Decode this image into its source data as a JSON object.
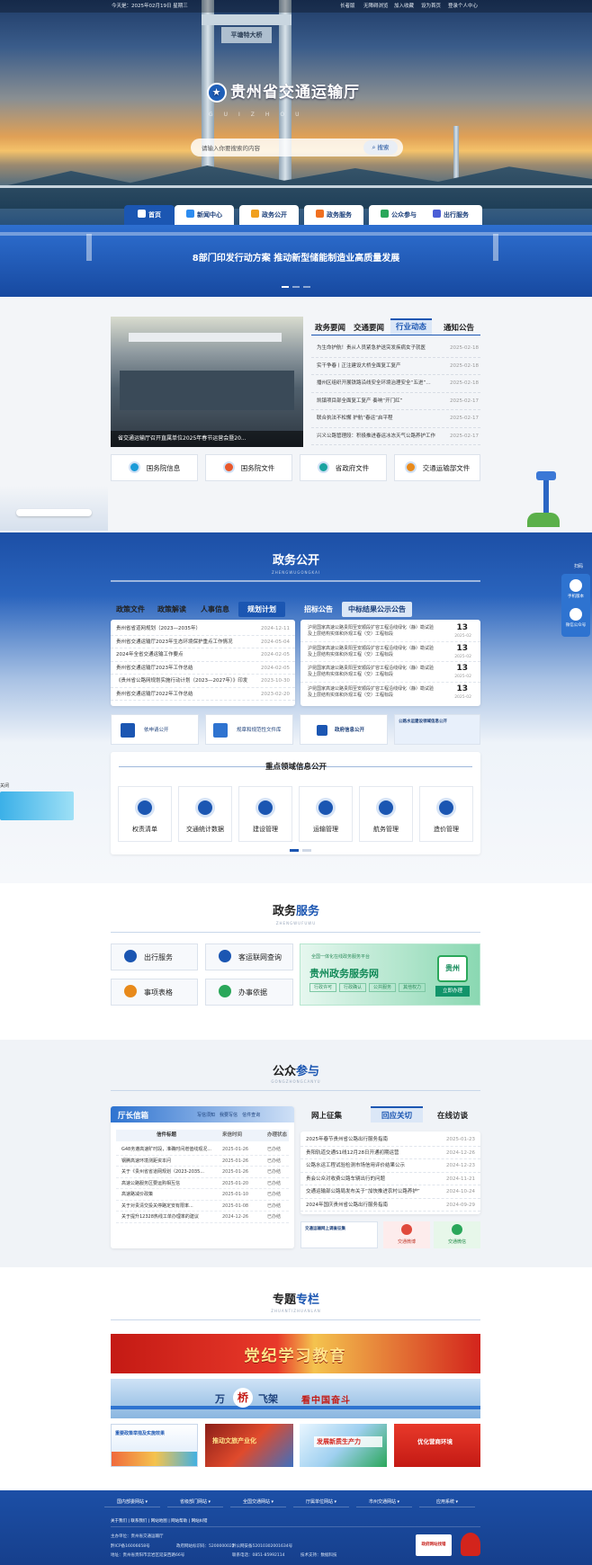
{
  "topbar": {
    "date": "今天是：2025年02月19日 星期三",
    "links": [
      "长者版",
      "无障碍浏览",
      "加入收藏",
      "设为首页",
      "登录个人中心"
    ]
  },
  "site": {
    "name": "贵州省交通运输厅",
    "pinyin": "GUIZHOU",
    "search_placeholder": "请输入你要搜索的内容",
    "search_button": "搜索",
    "bridge_text": "平塘特大桥"
  },
  "nav": {
    "items": [
      "首页",
      "新闻中心",
      "政务公开",
      "政务服务",
      "公众参与",
      "出行服务"
    ]
  },
  "banner": {
    "headline": "8部门印发行动方案 推动新型储能制造业高质量发展"
  },
  "news": {
    "photo_caption": "省交通运输厅召开直属单位2025年春节运营会暨20...",
    "tabs": [
      "政务要闻",
      "交通要闻",
      "行业动态",
      "通知公告"
    ],
    "items": [
      {
        "title": "为生命护航！贵从人员紧急护送突发疾病女子就医",
        "date": "2025-02-18"
      },
      {
        "title": "实干争春丨正注建设大桥全面复工复产",
        "date": "2025-02-18"
      },
      {
        "title": "播州区组织开展铁路沿线安全环境治理安全“五进”宣传",
        "date": "2025-02-18"
      },
      {
        "title": "凯镇项目部全面复工复产 奏响“开门红”",
        "date": "2025-02-17"
      },
      {
        "title": "联合执法不松懈 护航“春运”启平程",
        "date": "2025-02-17"
      },
      {
        "title": "兴义公路管理段：积极推进春运冰冻天气公路养护工作",
        "date": "2025-02-17"
      }
    ],
    "quick": [
      "国务院信息",
      "国务院文件",
      "省政府文件",
      "交通运输部文件"
    ]
  },
  "zwgk": {
    "title": "政务公开",
    "subtitle": "ZHENGWUGONGKAI",
    "left_tabs": [
      "政策文件",
      "政策解读",
      "人事信息",
      "规划计划"
    ],
    "left_items": [
      {
        "title": "贵州省省道网规划（2023—2035年）",
        "date": "2024-12-11"
      },
      {
        "title": "贵州省交通运输厅2023年生态环境保护重点工作情况",
        "date": "2024-05-04"
      },
      {
        "title": "2024年全省交通运输工作要点",
        "date": "2024-02-05"
      },
      {
        "title": "贵州省交通运输厅2023年工作总结",
        "date": "2024-02-05"
      },
      {
        "title": "《贵州省公路网规划实施行动计划（2023—2027年）》印发",
        "date": "2023-10-30"
      },
      {
        "title": "贵州省交通运输厅2022年工作总结",
        "date": "2023-02-20"
      }
    ],
    "right_tabs": [
      "招标公告",
      "中标结果公示公告"
    ],
    "bids": [
      {
        "title": "沪昆国家高速公路贵阳至安顺段扩容工程沿线绿化（静）勘试验及上层结构实体和外观工程（交）工程标段",
        "day": "13",
        "month": "2025-02"
      },
      {
        "title": "沪昆国家高速公路贵阳至安顺段扩容工程沿线绿化（静）勘试验及上层结构实体和外观工程（交）工程标段",
        "day": "13",
        "month": "2025-02"
      },
      {
        "title": "沪昆国家高速公路贵阳至安顺段扩容工程沿线绿化（静）勘试验及上层结构实体和外观工程（交）工程标段",
        "day": "13",
        "month": "2025-02"
      },
      {
        "title": "沪昆国家高速公路贵阳至安顺段扩容工程沿线绿化（静）勘试验及上层结构实体和外观工程（交）工程标段",
        "day": "13",
        "month": "2025-02"
      }
    ],
    "mini": [
      "依申请公开",
      "规章和规范性文件库",
      "政府信息公开",
      "公路水运建设领域信息公开"
    ],
    "key_title": "重点领域信息公开",
    "keys": [
      "权责清单",
      "交通统计数据",
      "建设管理",
      "运输管理",
      "航务管理",
      "造价管理"
    ]
  },
  "sidefloat": {
    "label": "扫码",
    "items": [
      "手机版本",
      "微信公众号"
    ],
    "close": "关闭"
  },
  "zwfw": {
    "title_a": "政务",
    "title_b": "服务",
    "subtitle": "ZHENGWUFUWU",
    "items": [
      "出行服务",
      "客运联网查询",
      "事项表格",
      "办事依据"
    ],
    "promo_top": "全国一体化在线政务服务平台",
    "promo_title": "贵州政务服务网",
    "promo_tags": [
      "行政许可",
      "行政确认",
      "公共服务",
      "其他权力"
    ],
    "promo_btn": "立即办理",
    "promo_badge": "贵州"
  },
  "gzcy": {
    "title_a": "公众",
    "title_b": "参与",
    "subtitle": "GONGZHONGCANYU",
    "box_title": "厅长信箱",
    "box_links": [
      "写信须知",
      "我要写信",
      "信件查询"
    ],
    "columns": [
      "信件标题",
      "来信时间",
      "办理状态"
    ],
    "rows": [
      {
        "t": "G48务遵高速旷时段，准确时间增值线观况...",
        "d": "2025-01-26",
        "s": "已办结"
      },
      {
        "t": "钢腾高速环境测距资本问",
        "d": "2025-01-26",
        "s": "已办结"
      },
      {
        "t": "关于《贵州省省道网规划（2023-2035...",
        "d": "2025-01-26",
        "s": "已办结"
      },
      {
        "t": "高速公路服务区要运购相互信",
        "d": "2025-01-20",
        "s": "已办结"
      },
      {
        "t": "高速路减价政策",
        "d": "2025-01-10",
        "s": "已办结"
      },
      {
        "t": "关于对贵清交投关停路定安有限率...",
        "d": "2025-01-08",
        "s": "已办结"
      },
      {
        "t": "关于提升12328热线工单办理率的建议",
        "d": "2024-12-26",
        "s": "已办结"
      }
    ],
    "tabs": [
      "网上征集",
      "回应关切",
      "在线访谈"
    ],
    "items": [
      {
        "title": "2025年春节贵州省公路出行服务指南",
        "date": "2025-01-23"
      },
      {
        "title": "贵阳轨道交通S1线12月28日开通初期运营",
        "date": "2024-12-26"
      },
      {
        "title": "公路水运工程试验检测市场信用评价结果公示",
        "date": "2024-12-23"
      },
      {
        "title": "贵会公众对收费公路车辆出行的问题",
        "date": "2024-11-21"
      },
      {
        "title": "交通运输部公路局发布关于“加快推进农村公路养护”",
        "date": "2024-10-24"
      },
      {
        "title": "2024年国庆贵州省公路出行服务指南",
        "date": "2024-09-29"
      }
    ],
    "social": [
      "交通微博",
      "交通微信"
    ],
    "mini_card": "交通运输网上调查征集"
  },
  "ztzl": {
    "title_a": "专题",
    "title_b": "专栏",
    "subtitle": "ZHUANTIZHUANLAN",
    "banner1": "党纪学习教育",
    "banner2_a": "万",
    "banner2_b": "桥",
    "banner2_c": "飞架",
    "banner2_d": "看中国奋斗",
    "small": [
      "重要政策举措及实施效果",
      "推动文旅产业化",
      "发展新质生产力",
      "优化营商环境"
    ]
  },
  "footer": {
    "selects": [
      "国内部委网站",
      "省级部门网站",
      "全国交通网站",
      "厅属单位网站",
      "市州交通网站",
      "应用系统"
    ],
    "links": [
      "关于我们",
      "联系我们",
      "网站地图",
      "网站帮助",
      "网站纠错"
    ],
    "lines": [
      "主办单位：贵州省交通运输厅",
      "政府网站标识码：5200000022",
      "黔公网安备52010302001634号",
      "黔ICP备16006658号",
      "地址：贵州省贵阳市云岩区延安西路66号",
      "联系电话：0851-85992114",
      "技术支持：数据科技"
    ],
    "badge": "政府网站找错"
  },
  "colors": {
    "primary": "#1b56b2",
    "dark": "#163f8c",
    "accent": "#d93a2b"
  }
}
